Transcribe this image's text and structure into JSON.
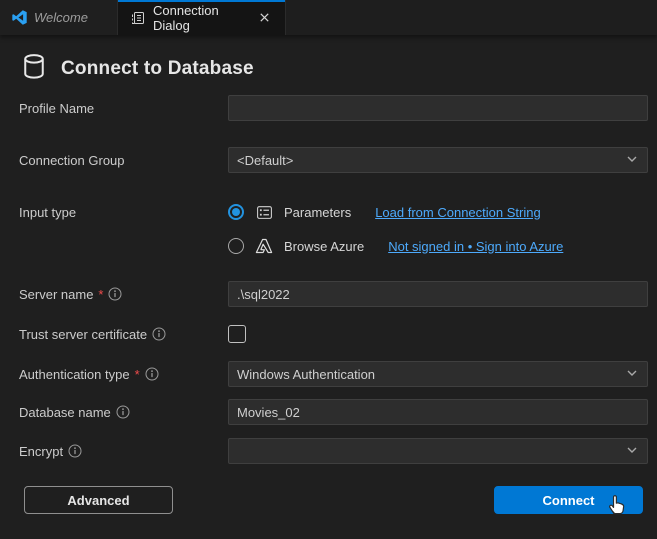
{
  "tabs": [
    {
      "label": "Welcome",
      "active": false
    },
    {
      "label": "Connection Dialog",
      "active": true
    }
  ],
  "header": {
    "title": "Connect to Database"
  },
  "form": {
    "profile_name": {
      "label": "Profile Name",
      "value": "",
      "placeholder": ""
    },
    "connection_group": {
      "label": "Connection Group",
      "value": "<Default>"
    },
    "input_type": {
      "label": "Input type",
      "options": [
        {
          "label": "Parameters",
          "selected": true,
          "link": "Load from Connection String"
        },
        {
          "label": "Browse Azure",
          "selected": false,
          "link": "Not signed in • Sign into Azure"
        }
      ]
    },
    "server_name": {
      "label": "Server name",
      "required": "*",
      "value": ".\\sql2022"
    },
    "trust_server_certificate": {
      "label": "Trust server certificate",
      "checked": false
    },
    "authentication_type": {
      "label": "Authentication type",
      "required": "*",
      "value": "Windows Authentication"
    },
    "database_name": {
      "label": "Database name",
      "value": "Movies_02"
    },
    "encrypt": {
      "label": "Encrypt",
      "value": ""
    }
  },
  "buttons": {
    "advanced": "Advanced",
    "connect": "Connect"
  },
  "colors": {
    "accent": "#0078d4",
    "link": "#4daafc",
    "required": "#f14c4c",
    "background": "#1f1f1f"
  }
}
